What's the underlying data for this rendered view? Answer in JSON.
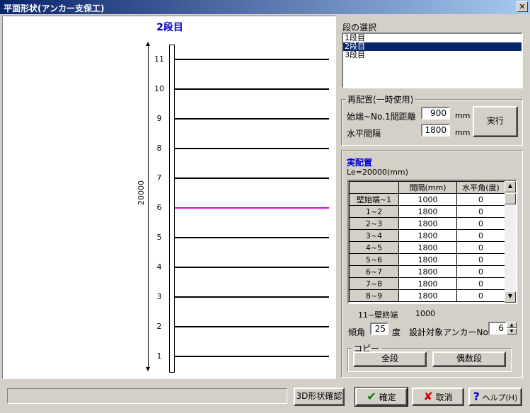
{
  "window": {
    "title": "平面形状(アンカー支保工)",
    "close_glyph": "✕"
  },
  "drawing": {
    "stage_title": "2段目",
    "dimension_label": "20000",
    "tiers": [
      "11",
      "10",
      "9",
      "8",
      "7",
      "6",
      "5",
      "4",
      "3",
      "2",
      "1"
    ],
    "selected_tier": "6",
    "selected_color": "#e000e0"
  },
  "stage_select": {
    "label": "段の選択",
    "items": [
      "1段目",
      "2段目",
      "3段目"
    ],
    "selected_index": 1
  },
  "reposition": {
    "legend": "再配置(一時使用)",
    "start_label": "始端~No.1間距離",
    "start_value": "900",
    "start_unit": "mm",
    "spacing_label": "水平間隔",
    "spacing_value": "1800",
    "spacing_unit": "mm",
    "execute_label": "実行"
  },
  "actual": {
    "title": "実配置",
    "le_text": "Le=20000(mm)",
    "columns": [
      "",
      "間隔(mm)",
      "水平角(度)"
    ],
    "rows": [
      [
        "壁始端~1",
        "1000",
        "0"
      ],
      [
        "1~2",
        "1800",
        "0"
      ],
      [
        "2~3",
        "1800",
        "0"
      ],
      [
        "3~4",
        "1800",
        "0"
      ],
      [
        "4~5",
        "1800",
        "0"
      ],
      [
        "5~6",
        "1800",
        "0"
      ],
      [
        "6~7",
        "1800",
        "0"
      ],
      [
        "7~8",
        "1800",
        "0"
      ],
      [
        "8~9",
        "1800",
        "0"
      ]
    ],
    "end_label": "11~壁終端",
    "end_value": "1000",
    "incline_label": "傾角",
    "incline_value": "25",
    "incline_unit": "度",
    "target_label": "設計対象アンカーNo.",
    "target_value": "6"
  },
  "copy": {
    "legend": "コピー",
    "all_label": "全段",
    "even_label": "偶数段"
  },
  "footer": {
    "status_text": "",
    "confirm3d_label": "3D形状確認",
    "ok_label": "確定",
    "cancel_label": "取消",
    "help_label": "ヘルプ(H)"
  }
}
